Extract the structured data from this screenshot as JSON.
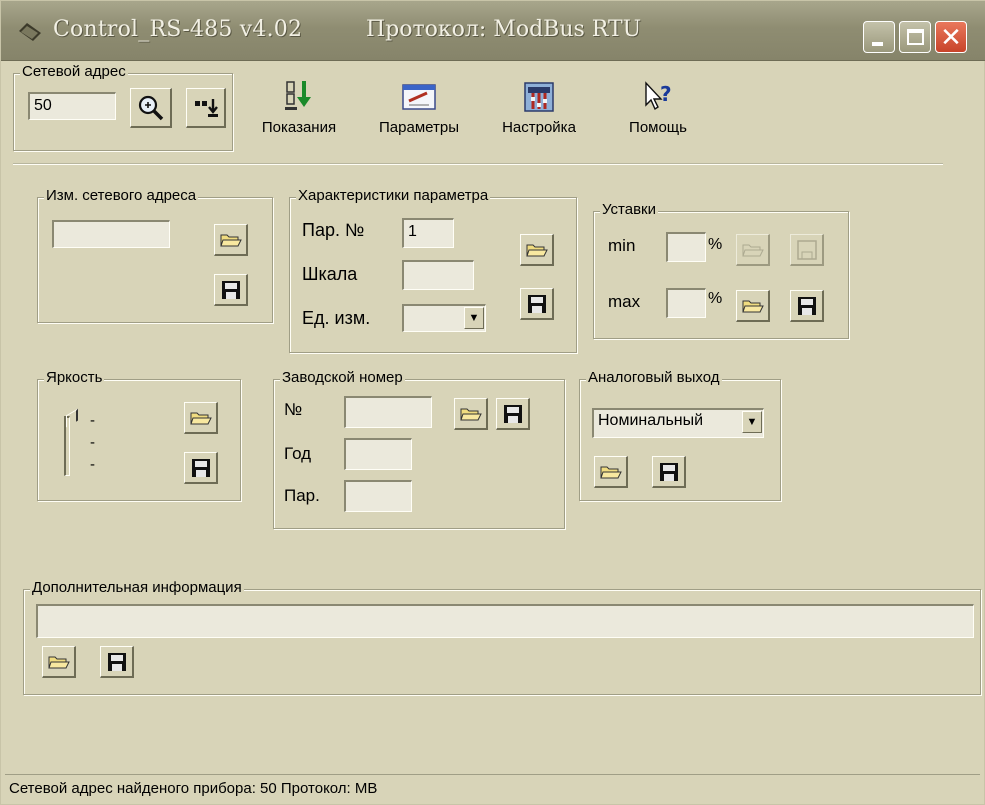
{
  "window": {
    "title": "Control_RS-485 v4.02",
    "protocol": "Протокол: ModBus RTU",
    "close_glyph": "✕"
  },
  "toolbar": {
    "net_address_legend": "Сетевой адрес",
    "net_address_value": "50",
    "items": [
      {
        "label": "Показания",
        "icon": "readings-icon"
      },
      {
        "label": "Параметры",
        "icon": "parameters-icon"
      },
      {
        "label": "Настройка",
        "icon": "settings-icon"
      },
      {
        "label": "Помощь",
        "icon": "help-icon"
      }
    ]
  },
  "change_address": {
    "legend": "Изм. сетевого адреса",
    "value": ""
  },
  "param": {
    "legend": "Характеристики параметра",
    "num_label": "Пар. №",
    "num_value": "1",
    "scale_label": "Шкала",
    "scale_value": "",
    "unit_label": "Ед. изм.",
    "unit_value": ""
  },
  "setpoints": {
    "legend": "Уставки",
    "min_label": "min",
    "max_label": "max",
    "percent": "%",
    "min_value": "",
    "max_value": ""
  },
  "brightness": {
    "legend": "Яркость",
    "ticks": [
      "-",
      "-",
      "-"
    ]
  },
  "serial": {
    "legend": "Заводской номер",
    "num_label": "№",
    "year_label": "Год",
    "par_label": "Пар.",
    "num_value": "",
    "year_value": "",
    "par_value": ""
  },
  "analog": {
    "legend": "Аналоговый выход",
    "mode": "Номинальный"
  },
  "extra": {
    "legend": "Дополнительная информация",
    "value": ""
  },
  "status": {
    "text": "Сетевой адрес найденого прибора: 50    Протокол: MB"
  },
  "colors": {
    "window_bg": "#d8d4b8",
    "titlebar": "#8f8d72",
    "close": "#c8442a"
  }
}
